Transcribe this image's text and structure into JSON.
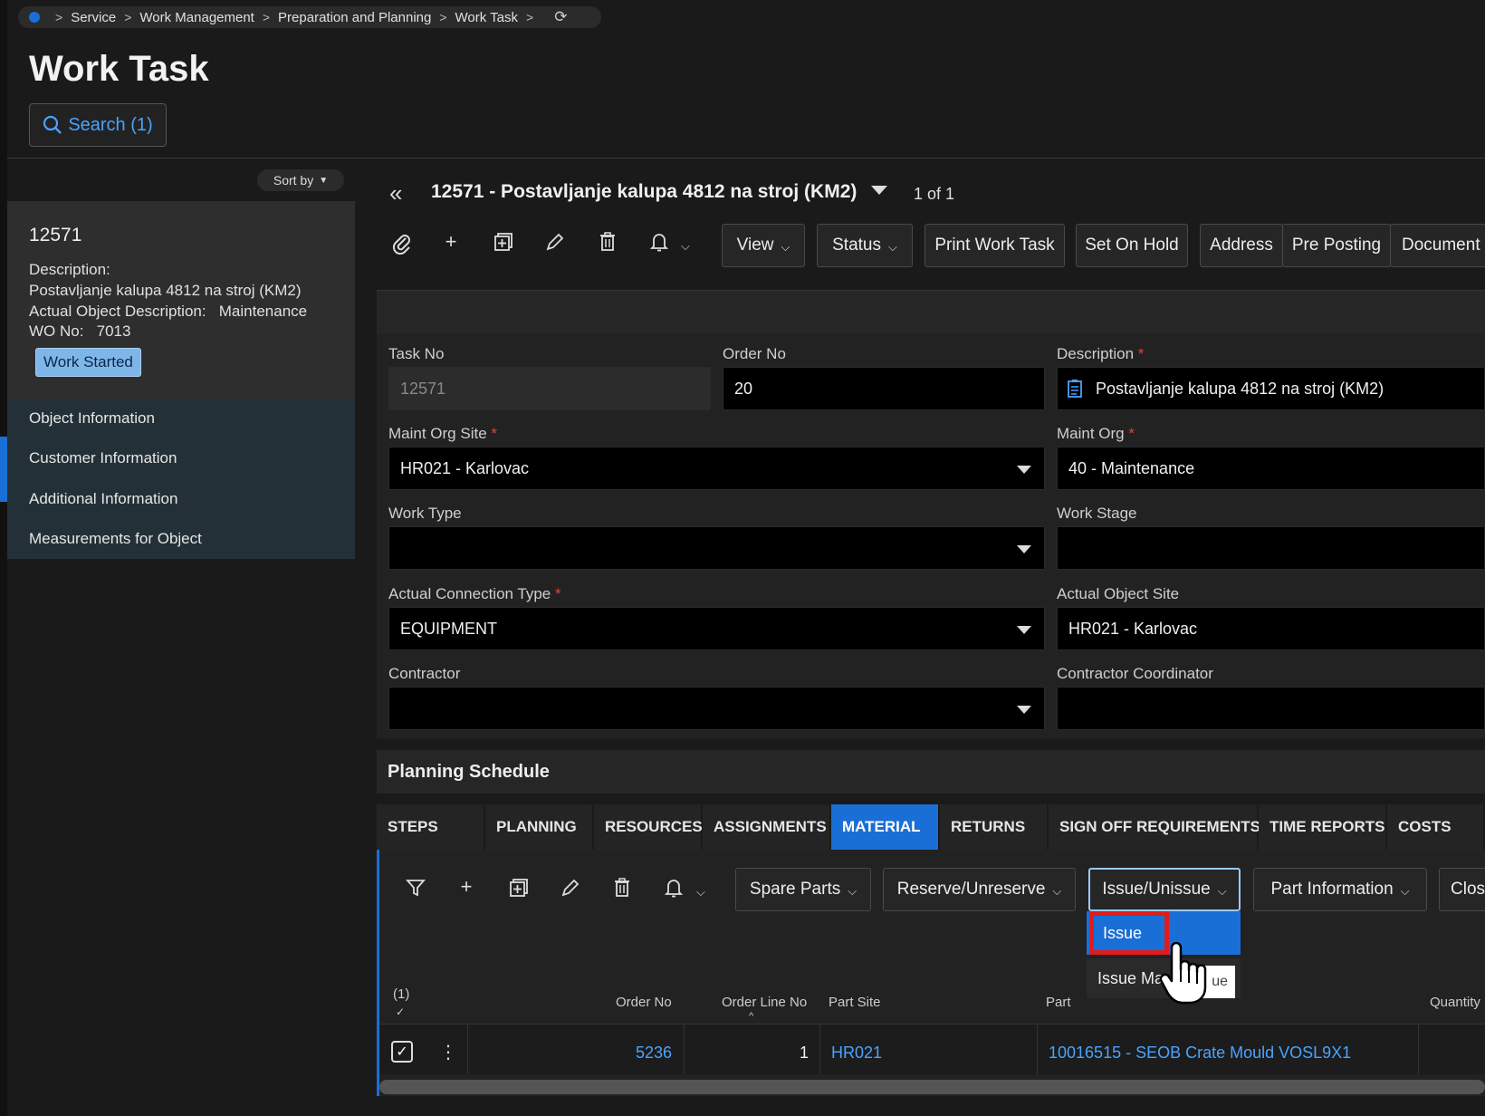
{
  "breadcrumb": [
    "Service",
    "Work Management",
    "Preparation and Planning",
    "Work Task"
  ],
  "page_title": "Work Task",
  "search_label": "Search (1)",
  "sort_label": "Sort by",
  "card": {
    "number": "12571",
    "description_label": "Description:",
    "description_value": "Postavljanje kalupa 4812 na stroj (KM2)",
    "actual_object_label": "Actual Object Description:",
    "actual_object_value": "Maintenance",
    "wo_label": "WO No:",
    "wo_value": "7013",
    "status_badge": "Work Started"
  },
  "nav_items": [
    "Object Information",
    "Customer Information",
    "Additional Information",
    "Measurements for Object"
  ],
  "record": {
    "title": "12571 - Postavljanje kalupa 4812 na stroj (KM2)",
    "count": "1 of 1"
  },
  "toolbar": {
    "view": "View",
    "status": "Status",
    "print": "Print Work Task",
    "hold": "Set On Hold",
    "address": "Address",
    "preposting": "Pre Posting",
    "document": "Document"
  },
  "form": {
    "task_no_label": "Task No",
    "task_no": "12571",
    "order_no_label": "Order No",
    "order_no": "20",
    "description_label": "Description",
    "description": "Postavljanje kalupa 4812 na stroj (KM2)",
    "maint_org_site_label": "Maint Org Site",
    "maint_org_site": "HR021 - Karlovac",
    "maint_org_label": "Maint Org",
    "maint_org": "40 - Maintenance",
    "work_type_label": "Work Type",
    "work_type": "",
    "work_stage_label": "Work Stage",
    "work_stage": "",
    "conn_type_label": "Actual Connection Type",
    "conn_type": "EQUIPMENT",
    "obj_site_label": "Actual Object Site",
    "obj_site": "HR021 - Karlovac",
    "contractor_label": "Contractor",
    "contractor": "",
    "coordinator_label": "Contractor Coordinator",
    "coordinator": ""
  },
  "planning_title": "Planning Schedule",
  "tabs": [
    "STEPS",
    "PLANNING",
    "RESOURCES",
    "ASSIGNMENTS",
    "MATERIAL",
    "RETURNS",
    "SIGN OFF REQUIREMENTS",
    "TIME REPORTS",
    "COSTS"
  ],
  "mat_toolbar": {
    "spare": "Spare Parts",
    "reserve": "Reserve/Unreserve",
    "issue": "Issue/Unissue",
    "partinfo": "Part Information",
    "close": "Close"
  },
  "dropdown": {
    "issue": "Issue",
    "issue_mat": "Issue Ma",
    "tooltip": "ue"
  },
  "table": {
    "selected_count": "(1)",
    "headers": [
      "Order No",
      "Order Line No",
      "Part Site",
      "Part",
      "Quantity"
    ],
    "row": {
      "order_no": "5236",
      "line_no": "1",
      "site": "HR021",
      "part": "10016515 - SEOB Crate Mould VOSL9X1"
    }
  }
}
